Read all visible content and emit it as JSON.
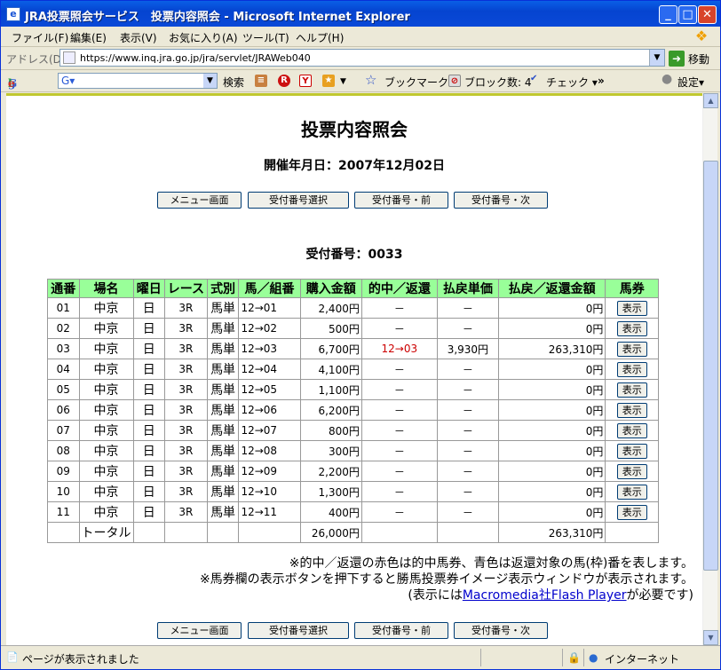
{
  "window": {
    "title": "JRA投票照会サービス　投票内容照会 - Microsoft Internet Explorer"
  },
  "menu": [
    "ファイル(F)",
    "編集(E)",
    "表示(V)",
    "お気に入り(A)",
    "ツール(T)",
    "ヘルプ(H)"
  ],
  "address": {
    "label": "アドレス(D)",
    "url": "https://www.inq.jra.go.jp/jra/servlet/JRAWeb040",
    "go": "移動"
  },
  "google": {
    "logo": "Google",
    "search_value": "G▾",
    "search": "検索",
    "bookmark": "ブックマーク▾",
    "popup": "ブロック数: 4",
    "check": "チェック ▾",
    "more": "»",
    "settings": "設定▾"
  },
  "page": {
    "title": "投票内容照会",
    "date": "開催年月日：2007年12月02日",
    "receipt": "受付番号：0033"
  },
  "nav": [
    "メニュー画面",
    "受付番号選択",
    "受付番号・前",
    "受付番号・次"
  ],
  "table": {
    "headers": [
      "通番",
      "場名",
      "曜日",
      "レース",
      "式別",
      "馬／組番",
      "購入金額",
      "的中／返還",
      "払戻単価",
      "払戻／返還金額",
      "馬券"
    ],
    "rows": [
      [
        "01",
        "中京",
        "日",
        "3R",
        "馬単",
        "12→01",
        "2,400円",
        "－",
        "－",
        "0円",
        "表示"
      ],
      [
        "02",
        "中京",
        "日",
        "3R",
        "馬単",
        "12→02",
        "500円",
        "－",
        "－",
        "0円",
        "表示"
      ],
      [
        "03",
        "中京",
        "日",
        "3R",
        "馬単",
        "12→03",
        "6,700円",
        "12→03",
        "3,930円",
        "263,310円",
        "表示"
      ],
      [
        "04",
        "中京",
        "日",
        "3R",
        "馬単",
        "12→04",
        "4,100円",
        "－",
        "－",
        "0円",
        "表示"
      ],
      [
        "05",
        "中京",
        "日",
        "3R",
        "馬単",
        "12→05",
        "1,100円",
        "－",
        "－",
        "0円",
        "表示"
      ],
      [
        "06",
        "中京",
        "日",
        "3R",
        "馬単",
        "12→06",
        "6,200円",
        "－",
        "－",
        "0円",
        "表示"
      ],
      [
        "07",
        "中京",
        "日",
        "3R",
        "馬単",
        "12→07",
        "800円",
        "－",
        "－",
        "0円",
        "表示"
      ],
      [
        "08",
        "中京",
        "日",
        "3R",
        "馬単",
        "12→08",
        "300円",
        "－",
        "－",
        "0円",
        "表示"
      ],
      [
        "09",
        "中京",
        "日",
        "3R",
        "馬単",
        "12→09",
        "2,200円",
        "－",
        "－",
        "0円",
        "表示"
      ],
      [
        "10",
        "中京",
        "日",
        "3R",
        "馬単",
        "12→10",
        "1,300円",
        "－",
        "－",
        "0円",
        "表示"
      ],
      [
        "11",
        "中京",
        "日",
        "3R",
        "馬単",
        "12→11",
        "400円",
        "－",
        "－",
        "0円",
        "表示"
      ]
    ],
    "total_label": "トータル",
    "total_purchase": "26,000円",
    "total_payout": "263,310円",
    "hit_color": "#cc0000"
  },
  "notes": {
    "line1": "※的中／返還の赤色は的中馬券、青色は返還対象の馬(枠)番を表します。",
    "line2": "※馬券欄の表示ボタンを押下すると勝馬投票券イメージ表示ウィンドウが表示されます。",
    "line3_pre": "(表示には",
    "line3_link": "Macromedia社Flash Player",
    "line3_post": "が必要です)"
  },
  "status": {
    "text": "ページが表示されました",
    "zone": "インターネット"
  }
}
